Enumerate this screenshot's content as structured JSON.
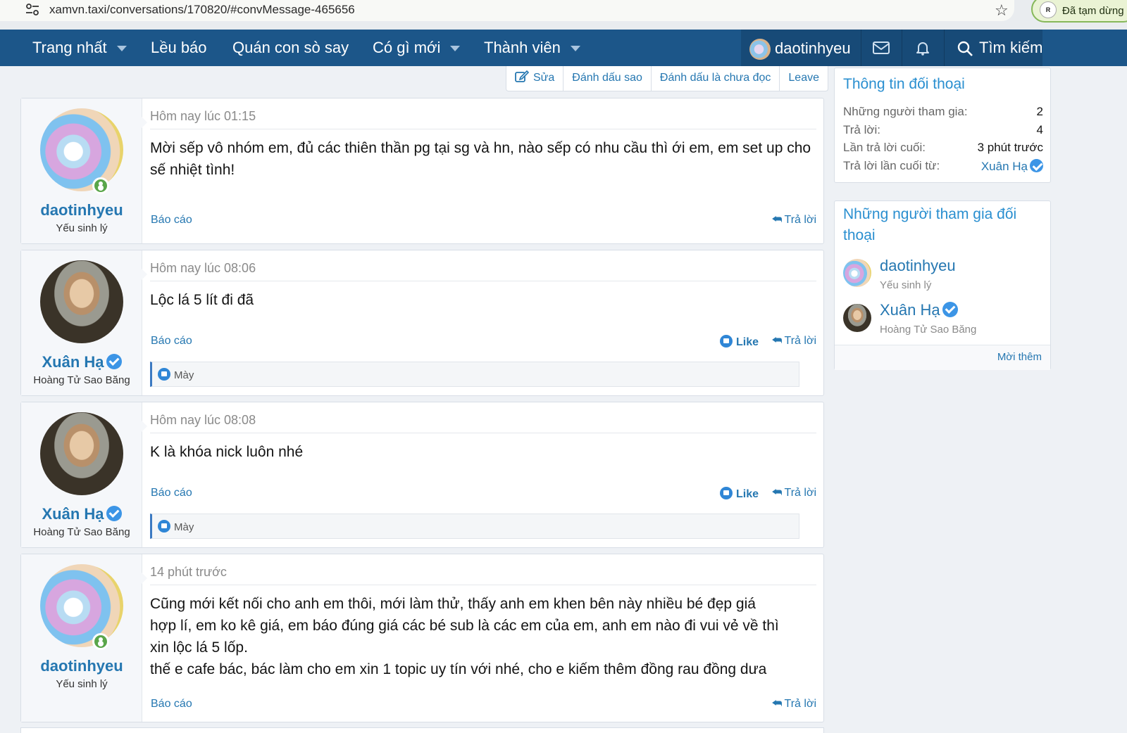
{
  "browser": {
    "url": "xamvn.taxi/conversations/170820/#convMessage-465656",
    "paused_label": "Đã tạm dừng",
    "paused_avatar": "R"
  },
  "nav": {
    "items": [
      {
        "label": "Trang nhất",
        "dropdown": true
      },
      {
        "label": "Lều báo",
        "dropdown": false
      },
      {
        "label": "Quán con sò say",
        "dropdown": false
      },
      {
        "label": "Có gì mới",
        "dropdown": true
      },
      {
        "label": "Thành viên",
        "dropdown": true
      }
    ],
    "user": "daotinhyeu",
    "search": "Tìm kiếm"
  },
  "actions": {
    "edit": "Sửa",
    "star": "Đánh dấu sao",
    "unread": "Đánh dấu là chưa đọc",
    "leave": "Leave"
  },
  "messages": [
    {
      "author": "daotinhyeu",
      "title": "Yếu sinh lý",
      "time": "Hôm nay lúc 01:15",
      "body": "Mời sếp vô nhóm em, đủ các thiên thần pg tại sg và hn, nào sếp có nhu cầu thì ới em, em set up cho sế nhiệt tình!",
      "report": "Báo cáo",
      "reply": "Trả lời"
    },
    {
      "author": "Xuân Hạ",
      "title": "Hoàng Tử Sao Băng",
      "time": "Hôm nay lúc 08:06",
      "body": "Lộc lá 5 lít đi đã",
      "report": "Báo cáo",
      "like": "Like",
      "reply": "Trả lời",
      "reactions": "Mày"
    },
    {
      "author": "Xuân Hạ",
      "title": "Hoàng Tử Sao Băng",
      "time": "Hôm nay lúc 08:08",
      "body": "K là khóa nick luôn nhé",
      "report": "Báo cáo",
      "like": "Like",
      "reply": "Trả lời",
      "reactions": "Mày"
    },
    {
      "author": "daotinhyeu",
      "title": "Yếu sinh lý",
      "time": "14 phút trước",
      "body_lines": [
        "Cũng mới kết nối cho anh em thôi, mới làm thử, thấy anh em khen bên này nhiều bé đẹp giá",
        "hợp lí, em ko kê giá, em báo đúng giá các bé sub là các em của em, anh em nào đi vui vẻ về thì",
        "xin lộc lá 5 lốp.",
        "thế e cafe bác, bác làm cho em xin 1 topic uy tín với nhé, cho e kiếm thêm đồng rau đồng dưa"
      ],
      "report": "Báo cáo",
      "reply": "Trả lời"
    }
  ],
  "sidebar": {
    "info": {
      "title": "Thông tin đối thoại",
      "rows": [
        {
          "key": "Những người tham gia:",
          "value": "2"
        },
        {
          "key": "Trả lời:",
          "value": "4"
        },
        {
          "key": "Lần trả lời cuối:",
          "value": "3 phút trước"
        },
        {
          "key": "Trả lời lần cuối từ:",
          "value": "Xuân Hạ"
        }
      ]
    },
    "participants": {
      "title_line1": "Những người tham gia đối",
      "title_line2": "thoại",
      "list": [
        {
          "name": "daotinhyeu",
          "title": "Yếu sinh lý"
        },
        {
          "name": "Xuân Hạ",
          "title": "Hoàng Tử Sao Băng"
        }
      ],
      "invite": "Mời thêm"
    }
  },
  "colors": {
    "nav_bg": "#1c5689",
    "link": "#2577b1",
    "sidebar_title": "#2a8fd0",
    "verified": "#3c95e6",
    "online": "#5aa64a"
  }
}
